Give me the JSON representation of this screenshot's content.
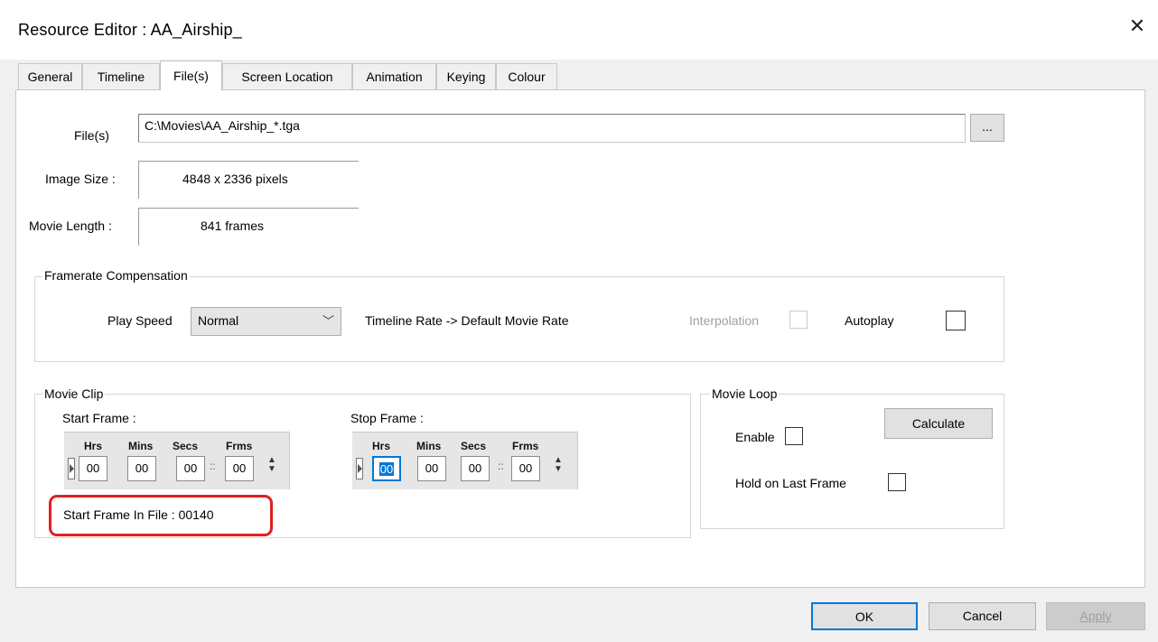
{
  "window": {
    "title": "Resource Editor  :  AA_Airship_"
  },
  "tabs": [
    {
      "label": "General"
    },
    {
      "label": "Timeline"
    },
    {
      "label": "File(s)"
    },
    {
      "label": "Screen Location"
    },
    {
      "label": "Animation"
    },
    {
      "label": "Keying"
    },
    {
      "label": "Colour"
    }
  ],
  "active_tab": "File(s)",
  "files": {
    "label": "File(s)",
    "value": "C:\\Movies\\AA_Airship_*.tga",
    "browse_label": "..."
  },
  "image_size": {
    "label": "Image Size :",
    "value": "4848 x 2336 pixels"
  },
  "movie_length": {
    "label": "Movie Length :",
    "value": "841  frames"
  },
  "framerate": {
    "title": "Framerate Compensation",
    "play_speed_label": "Play Speed",
    "play_speed_value": "Normal",
    "rate_text": "Timeline Rate -> Default Movie Rate",
    "interpolation_label": "Interpolation",
    "interpolation_checked": false,
    "interpolation_enabled": false,
    "autoplay_label": "Autoplay",
    "autoplay_checked": false
  },
  "movie_clip": {
    "title": "Movie Clip",
    "start_label": "Start Frame :",
    "stop_label": "Stop Frame :",
    "headers": {
      "hrs": "Hrs",
      "mins": "Mins",
      "secs": "Secs",
      "frms": "Frms"
    },
    "start": {
      "hrs": "00",
      "mins": "00",
      "secs": "00",
      "frms": "00"
    },
    "stop": {
      "hrs": "00",
      "mins": "00",
      "secs": "00",
      "frms": "00"
    },
    "start_in_file_text": "Start Frame In File : 00140"
  },
  "movie_loop": {
    "title": "Movie Loop",
    "enable_label": "Enable",
    "enable_checked": false,
    "calculate_label": "Calculate",
    "hold_label": "Hold on Last Frame",
    "hold_checked": false
  },
  "footer": {
    "ok": "OK",
    "cancel": "Cancel",
    "apply": "Apply"
  },
  "colors": {
    "dialog_bg": "#f0f0f0",
    "panel_bg": "#ffffff",
    "accent": "#0078d7",
    "highlight_ring": "#e02020",
    "disabled_text": "#a0a0a0"
  }
}
